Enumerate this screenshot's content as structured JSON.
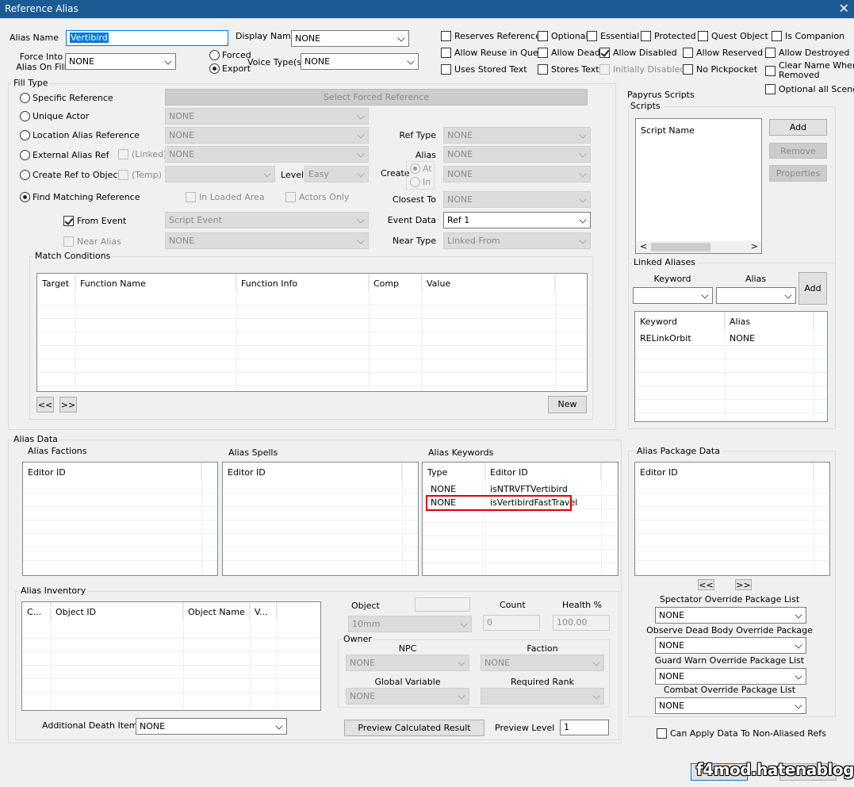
{
  "window": {
    "title": "Reference Alias",
    "close": "✕"
  },
  "header": {
    "alias_name_label": "Alias Name",
    "alias_name_value": "Vertibird",
    "display_name_label": "Display Name",
    "display_name_value": "NONE",
    "force_into_label_1": "Force Into",
    "force_into_label_2": "Alias On Fill",
    "force_into_value": "NONE",
    "forced_label": "Forced",
    "export_label": "Export",
    "voice_types_label": "Voice Type(s)",
    "voice_types_value": "NONE"
  },
  "flags": {
    "reserves_reference": "Reserves Reference",
    "optional": "Optional",
    "essential": "Essential",
    "protected": "Protected",
    "quest_object": "Quest Object",
    "is_companion": "Is Companion",
    "allow_reuse": "Allow Reuse in Quest",
    "allow_dead": "Allow Dead",
    "allow_disabled": "Allow Disabled",
    "allow_reserved": "Allow Reserved",
    "allow_destroyed": "Allow Destroyed",
    "uses_stored_text": "Uses Stored Text",
    "stores_text": "Stores Text",
    "initially_disabled": "Initially Disabled",
    "no_pickpocket": "No Pickpocket",
    "clear_name_1": "Clear Name When",
    "clear_name_2": "Removed",
    "optional_all_scenes": "Optional all Scenes"
  },
  "fill_type": {
    "group_label": "Fill Type",
    "specific_reference": "Specific Reference",
    "select_forced_reference": "Select Forced Reference",
    "unique_actor": "Unique Actor",
    "unique_actor_value": "NONE",
    "location_alias_reference": "Location Alias Reference",
    "location_alias_value": "NONE",
    "ref_type_label": "Ref Type",
    "ref_type_value": "NONE",
    "external_alias_ref": "External Alias Ref",
    "linked_label": "(Linked)",
    "external_value": "NONE",
    "alias_label": "Alias",
    "alias_value": "NONE",
    "create_ref_to_object": "Create Ref to Object",
    "temp_label": "(Temp)",
    "level_label": "Level",
    "level_value": "Easy",
    "create_label": "Create",
    "at_label": "At",
    "in_label": "In",
    "create_value": "NONE",
    "find_matching_reference": "Find Matching Reference",
    "in_loaded_area": "In Loaded Area",
    "actors_only": "Actors Only",
    "closest_to_label": "Closest To",
    "closest_to_value": "NONE",
    "from_event": "From Event",
    "script_event": "Script Event",
    "event_data_label": "Event Data",
    "event_data_value": "Ref 1",
    "near_alias": "Near Alias",
    "near_alias_value": "NONE",
    "near_type_label": "Near Type",
    "near_type_value": "Linked From",
    "match_conditions_label": "Match Conditions",
    "conditions_columns": [
      "Target",
      "Function Name",
      "Function Info",
      "Comp",
      "Value"
    ],
    "prev_button": "<<",
    "next_button": ">>",
    "new_button": "New"
  },
  "scripts": {
    "group_label": "Papyrus Scripts",
    "sub_label": "Scripts",
    "column": "Script Name",
    "add": "Add",
    "remove": "Remove",
    "properties": "Properties",
    "scroll_left": "<",
    "scroll_right": ">"
  },
  "linked_aliases": {
    "group_label": "Linked Aliases",
    "keyword_label": "Keyword",
    "alias_label": "Alias",
    "add": "Add",
    "columns": [
      "Keyword",
      "Alias"
    ],
    "rows": [
      {
        "keyword": "RELinkOrbit",
        "alias": "NONE"
      }
    ]
  },
  "alias_data": {
    "group_label": "Alias Data",
    "factions_label": "Alias Factions",
    "factions_column": "Editor ID",
    "spells_label": "Alias Spells",
    "spells_column": "Editor ID",
    "keywords_label": "Alias Keywords",
    "keywords_columns": [
      "Type",
      "Editor ID"
    ],
    "keywords_rows": [
      {
        "type": "NONE",
        "editor_id": "isNTRVFTVertibird"
      },
      {
        "type": "NONE",
        "editor_id": "isVertibirdFastTravel"
      }
    ],
    "highlight_color": "#e00000"
  },
  "package_data": {
    "group_label": "Alias Package Data",
    "column": "Editor ID",
    "prev": "<<",
    "next": ">>",
    "spectator_label": "Spectator Override Package List",
    "spectator_value": "NONE",
    "observe_label": "Observe Dead Body Override Package",
    "observe_value": "NONE",
    "guard_label": "Guard Warn Override Package List",
    "guard_value": "NONE",
    "combat_label": "Combat Override Package List",
    "combat_value": "NONE"
  },
  "inventory": {
    "group_label": "Alias Inventory",
    "columns": [
      "C...",
      "Object ID",
      "Object Name",
      "V..."
    ],
    "object_label": "Object",
    "object_value": "10mm",
    "count_label": "Count",
    "count_value": "0",
    "health_label": "Health %",
    "health_value": "100.00",
    "owner_label": "Owner",
    "npc_label": "NPC",
    "npc_value": "NONE",
    "faction_label": "Faction",
    "faction_value": "NONE",
    "global_variable_label": "Global Variable",
    "global_variable_value": "NONE",
    "required_rank_label": "Required Rank",
    "additional_death_item_label": "Additional Death Item",
    "additional_death_item_value": "NONE",
    "preview_button": "Preview Calculated Result",
    "preview_level_label": "Preview Level",
    "preview_level_value": "1"
  },
  "footer": {
    "can_apply": "Can Apply Data To Non-Aliased Refs",
    "watermark": "f4mod.hatenablog.com"
  }
}
